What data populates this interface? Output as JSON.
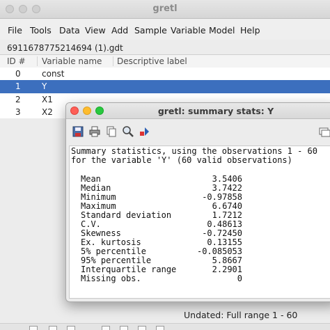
{
  "main_window": {
    "title": "gretl",
    "menu": [
      "File",
      "Tools",
      "Data",
      "View",
      "Add",
      "Sample",
      "Variable",
      "Model",
      "Help"
    ],
    "file_name": "6911678775214694 (1).gdt",
    "columns": [
      "ID #",
      "Variable name",
      "Descriptive label"
    ],
    "variables": [
      {
        "id": "0",
        "name": "const"
      },
      {
        "id": "1",
        "name": "Y"
      },
      {
        "id": "2",
        "name": "X1"
      },
      {
        "id": "3",
        "name": "X2"
      }
    ],
    "selected_id": "1",
    "status": "Undated: Full range 1 - 60"
  },
  "stats_window": {
    "title": "gretl: summary stats: Y",
    "toolbar_icons": [
      "save-icon",
      "print-icon",
      "copy-icon",
      "find-icon",
      "plot-icon",
      "window-list-icon"
    ],
    "header_line1": "Summary statistics, using the observations 1 - 60",
    "header_line2": "for the variable 'Y' (60 valid observations)",
    "stats": [
      {
        "label": "Mean",
        "value": "3.5406"
      },
      {
        "label": "Median",
        "value": "3.7422"
      },
      {
        "label": "Minimum",
        "value": "-0.97858"
      },
      {
        "label": "Maximum",
        "value": "6.6740"
      },
      {
        "label": "Standard deviation",
        "value": "1.7212"
      },
      {
        "label": "C.V.",
        "value": "0.48613"
      },
      {
        "label": "Skewness",
        "value": "-0.72450"
      },
      {
        "label": "Ex. kurtosis",
        "value": "0.13155"
      },
      {
        "label": "5% percentile",
        "value": "-0.085053"
      },
      {
        "label": "95% percentile",
        "value": "5.8667"
      },
      {
        "label": "Interquartile range",
        "value": "2.2901"
      },
      {
        "label": "Missing obs.",
        "value": "0"
      }
    ]
  },
  "colors": {
    "selection": "#3c6fbe",
    "close": "#fe5f57",
    "minimize": "#febc2e",
    "zoom": "#28c840"
  }
}
